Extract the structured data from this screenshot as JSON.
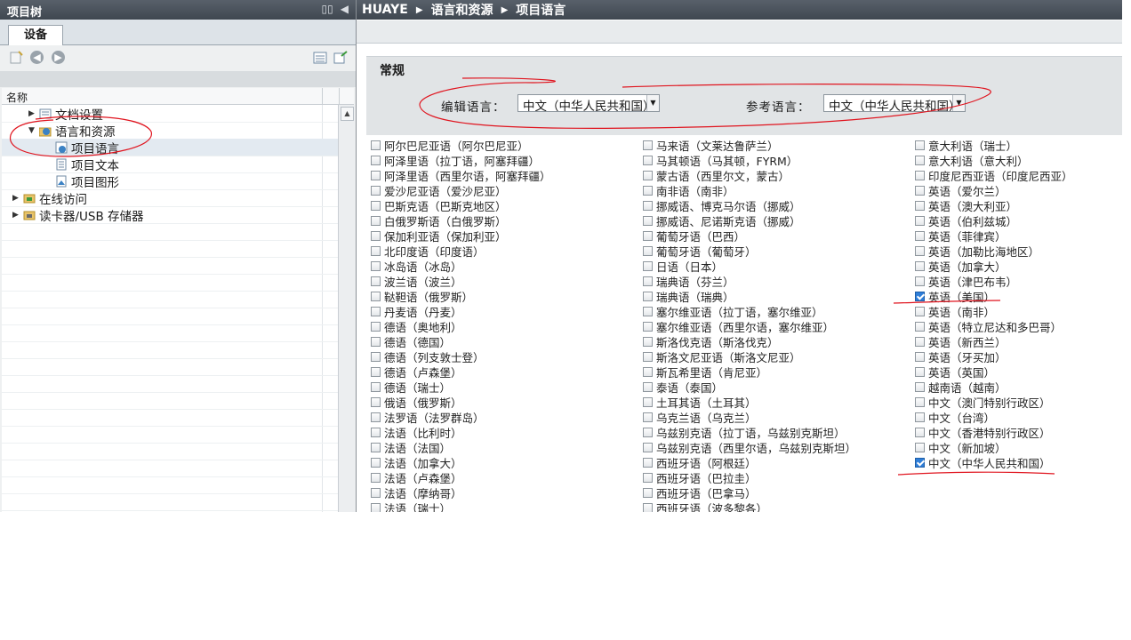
{
  "left_panel": {
    "title": "项目树",
    "title_buttons": [
      "▯▯",
      "◀"
    ],
    "device_tab": "设备",
    "column_header": "名称",
    "tree": [
      {
        "label": "文档设置",
        "arrow": "▶",
        "icon": "doc-settings-icon"
      },
      {
        "label": "语言和资源",
        "arrow": "▼",
        "icon": "language-resources-icon"
      },
      {
        "label": "项目语言",
        "arrow": "",
        "icon": "project-language-icon",
        "selected": true
      },
      {
        "label": "项目文本",
        "arrow": "",
        "icon": "project-text-icon"
      },
      {
        "label": "项目图形",
        "arrow": "",
        "icon": "project-graphics-icon"
      },
      {
        "label": "在线访问",
        "arrow": "▶",
        "icon": "online-access-icon"
      },
      {
        "label": "读卡器/USB 存储器",
        "arrow": "▶",
        "icon": "card-reader-icon"
      }
    ]
  },
  "breadcrumb": [
    "HUAYE",
    "语言和资源",
    "项目语言"
  ],
  "general": {
    "title": "常规",
    "edit_label": "编辑语言：",
    "edit_value": "中文（中华人民共和国）",
    "ref_label": "参考语言：",
    "ref_value": "中文（中华人民共和国）"
  },
  "languages": [
    [
      {
        "label": "阿尔巴尼亚语（阿尔巴尼亚）",
        "checked": false
      },
      {
        "label": "阿泽里语（拉丁语，阿塞拜疆）",
        "checked": false
      },
      {
        "label": "阿泽里语（西里尔语，阿塞拜疆）",
        "checked": false
      },
      {
        "label": "爱沙尼亚语（爱沙尼亚）",
        "checked": false
      },
      {
        "label": "巴斯克语（巴斯克地区）",
        "checked": false
      },
      {
        "label": "白俄罗斯语（白俄罗斯）",
        "checked": false
      },
      {
        "label": "保加利亚语（保加利亚）",
        "checked": false
      },
      {
        "label": "北印度语（印度语）",
        "checked": false
      },
      {
        "label": "冰岛语（冰岛）",
        "checked": false
      },
      {
        "label": "波兰语（波兰）",
        "checked": false
      },
      {
        "label": "鞑靼语（俄罗斯）",
        "checked": false
      },
      {
        "label": "丹麦语（丹麦）",
        "checked": false
      },
      {
        "label": "德语（奥地利）",
        "checked": false
      },
      {
        "label": "德语（德国）",
        "checked": false
      },
      {
        "label": "德语（列支敦士登）",
        "checked": false
      },
      {
        "label": "德语（卢森堡）",
        "checked": false
      },
      {
        "label": "德语（瑞士）",
        "checked": false
      },
      {
        "label": "俄语（俄罗斯）",
        "checked": false
      },
      {
        "label": "法罗语（法罗群岛）",
        "checked": false
      },
      {
        "label": "法语（比利时）",
        "checked": false
      },
      {
        "label": "法语（法国）",
        "checked": false
      },
      {
        "label": "法语（加拿大）",
        "checked": false
      },
      {
        "label": "法语（卢森堡）",
        "checked": false
      },
      {
        "label": "法语（摩纳哥）",
        "checked": false
      },
      {
        "label": "法语（瑞士）",
        "checked": false
      }
    ],
    [
      {
        "label": "马来语（文莱达鲁萨兰）",
        "checked": false
      },
      {
        "label": "马其顿语（马其顿，FYRM）",
        "checked": false
      },
      {
        "label": "蒙古语（西里尔文，蒙古）",
        "checked": false
      },
      {
        "label": "南非语（南非）",
        "checked": false
      },
      {
        "label": "挪威语、博克马尔语（挪威）",
        "checked": false
      },
      {
        "label": "挪威语、尼诺斯克语（挪威）",
        "checked": false
      },
      {
        "label": "葡萄牙语（巴西）",
        "checked": false
      },
      {
        "label": "葡萄牙语（葡萄牙）",
        "checked": false
      },
      {
        "label": "日语（日本）",
        "checked": false
      },
      {
        "label": "瑞典语（芬兰）",
        "checked": false
      },
      {
        "label": "瑞典语（瑞典）",
        "checked": false
      },
      {
        "label": "塞尔维亚语（拉丁语，塞尔维亚）",
        "checked": false
      },
      {
        "label": "塞尔维亚语（西里尔语，塞尔维亚）",
        "checked": false
      },
      {
        "label": "斯洛伐克语（斯洛伐克）",
        "checked": false
      },
      {
        "label": "斯洛文尼亚语（斯洛文尼亚）",
        "checked": false
      },
      {
        "label": "斯瓦希里语（肯尼亚）",
        "checked": false
      },
      {
        "label": "泰语（泰国）",
        "checked": false
      },
      {
        "label": "土耳其语（土耳其）",
        "checked": false
      },
      {
        "label": "乌克兰语（乌克兰）",
        "checked": false
      },
      {
        "label": "乌兹别克语（拉丁语，乌兹别克斯坦）",
        "checked": false
      },
      {
        "label": "乌兹别克语（西里尔语，乌兹别克斯坦）",
        "checked": false
      },
      {
        "label": "西班牙语（阿根廷）",
        "checked": false
      },
      {
        "label": "西班牙语（巴拉圭）",
        "checked": false
      },
      {
        "label": "西班牙语（巴拿马）",
        "checked": false
      },
      {
        "label": "西班牙语（波多黎各）",
        "checked": false
      }
    ],
    [
      {
        "label": "意大利语（瑞士）",
        "checked": false
      },
      {
        "label": "意大利语（意大利）",
        "checked": false
      },
      {
        "label": "印度尼西亚语（印度尼西亚）",
        "checked": false
      },
      {
        "label": "英语（爱尔兰）",
        "checked": false
      },
      {
        "label": "英语（澳大利亚）",
        "checked": false
      },
      {
        "label": "英语（伯利兹城）",
        "checked": false
      },
      {
        "label": "英语（菲律宾）",
        "checked": false
      },
      {
        "label": "英语（加勒比海地区）",
        "checked": false
      },
      {
        "label": "英语（加拿大）",
        "checked": false
      },
      {
        "label": "英语（津巴布韦）",
        "checked": false
      },
      {
        "label": "英语（美国）",
        "checked": true
      },
      {
        "label": "英语（南非）",
        "checked": false
      },
      {
        "label": "英语（特立尼达和多巴哥）",
        "checked": false
      },
      {
        "label": "英语（新西兰）",
        "checked": false
      },
      {
        "label": "英语（牙买加）",
        "checked": false
      },
      {
        "label": "英语（英国）",
        "checked": false
      },
      {
        "label": "越南语（越南）",
        "checked": false
      },
      {
        "label": "中文（澳门特别行政区）",
        "checked": false
      },
      {
        "label": "中文（台湾）",
        "checked": false
      },
      {
        "label": "中文（香港特别行政区）",
        "checked": false
      },
      {
        "label": "中文（新加坡）",
        "checked": false
      },
      {
        "label": "中文（中华人民共和国）",
        "checked": true
      }
    ]
  ],
  "colors": {
    "accent": "#2f7ed8",
    "annotation": "#e0141e",
    "titlebar": "#4b535c"
  }
}
